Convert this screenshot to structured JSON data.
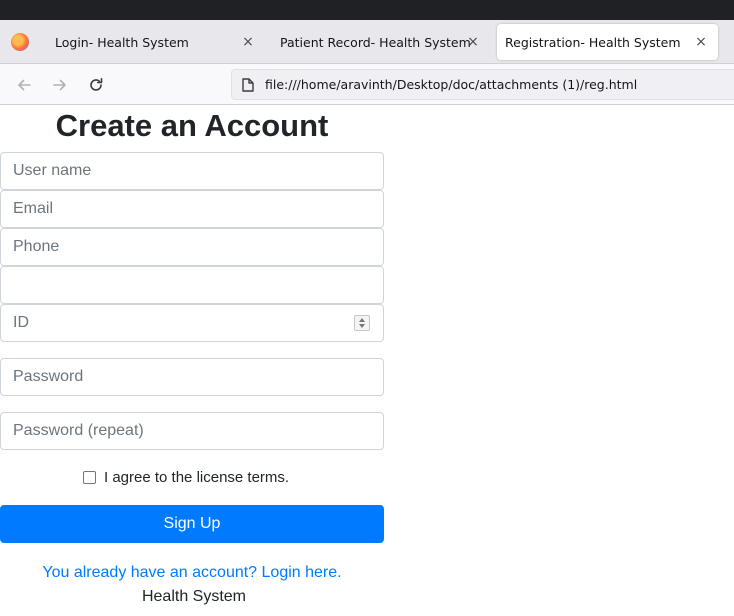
{
  "browser": {
    "tabs": [
      {
        "label": "Login- Health System",
        "close": "×",
        "active": false
      },
      {
        "label": "Patient Record- Health System",
        "close": "×",
        "active": false
      },
      {
        "label": "Registration- Health System",
        "close": "×",
        "active": true
      }
    ],
    "url": "file:///home/aravinth/Desktop/doc/attachments (1)/reg.html",
    "icons": [
      "firefox-logo",
      "back-arrow-icon",
      "forward-arrow-icon",
      "reload-icon",
      "page-icon"
    ]
  },
  "form": {
    "title": "Create an Account",
    "username_placeholder": "User name",
    "email_placeholder": "Email",
    "phone_placeholder": "Phone",
    "blank_value": "",
    "id_placeholder": "ID",
    "password_placeholder": "Password",
    "password_repeat_placeholder": "Password (repeat)",
    "terms_label": "I agree to the license terms.",
    "terms_checked": false,
    "submit_label": "Sign Up",
    "login_link": "You already have an account? Login here.",
    "footer": "Health System"
  },
  "colors": {
    "primary": "#007bff",
    "chrome_dark": "#202124",
    "tabstrip": "#e8e8ec",
    "input_border": "#ced4da"
  }
}
